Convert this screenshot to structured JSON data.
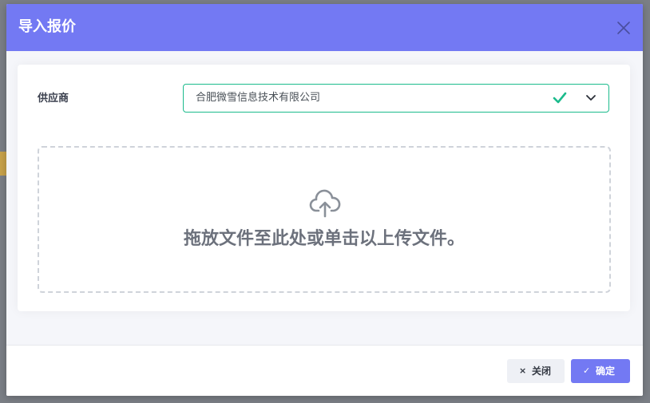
{
  "dialog": {
    "title": "导入报价",
    "close_icon": "close-icon"
  },
  "form": {
    "supplier_label": "供应商",
    "supplier_value": "合肥微雪信息技术有限公司",
    "valid_icon": "check-icon",
    "dropdown_icon": "chevron-down-icon"
  },
  "dropzone": {
    "icon": "cloud-upload-icon",
    "text": "拖放文件至此处或单击以上传文件。"
  },
  "footer": {
    "close_label": "关闭",
    "close_icon": "×",
    "confirm_label": "确定",
    "confirm_icon": "✓"
  },
  "colors": {
    "accent": "#7379f3",
    "success": "#1cbb8c"
  }
}
